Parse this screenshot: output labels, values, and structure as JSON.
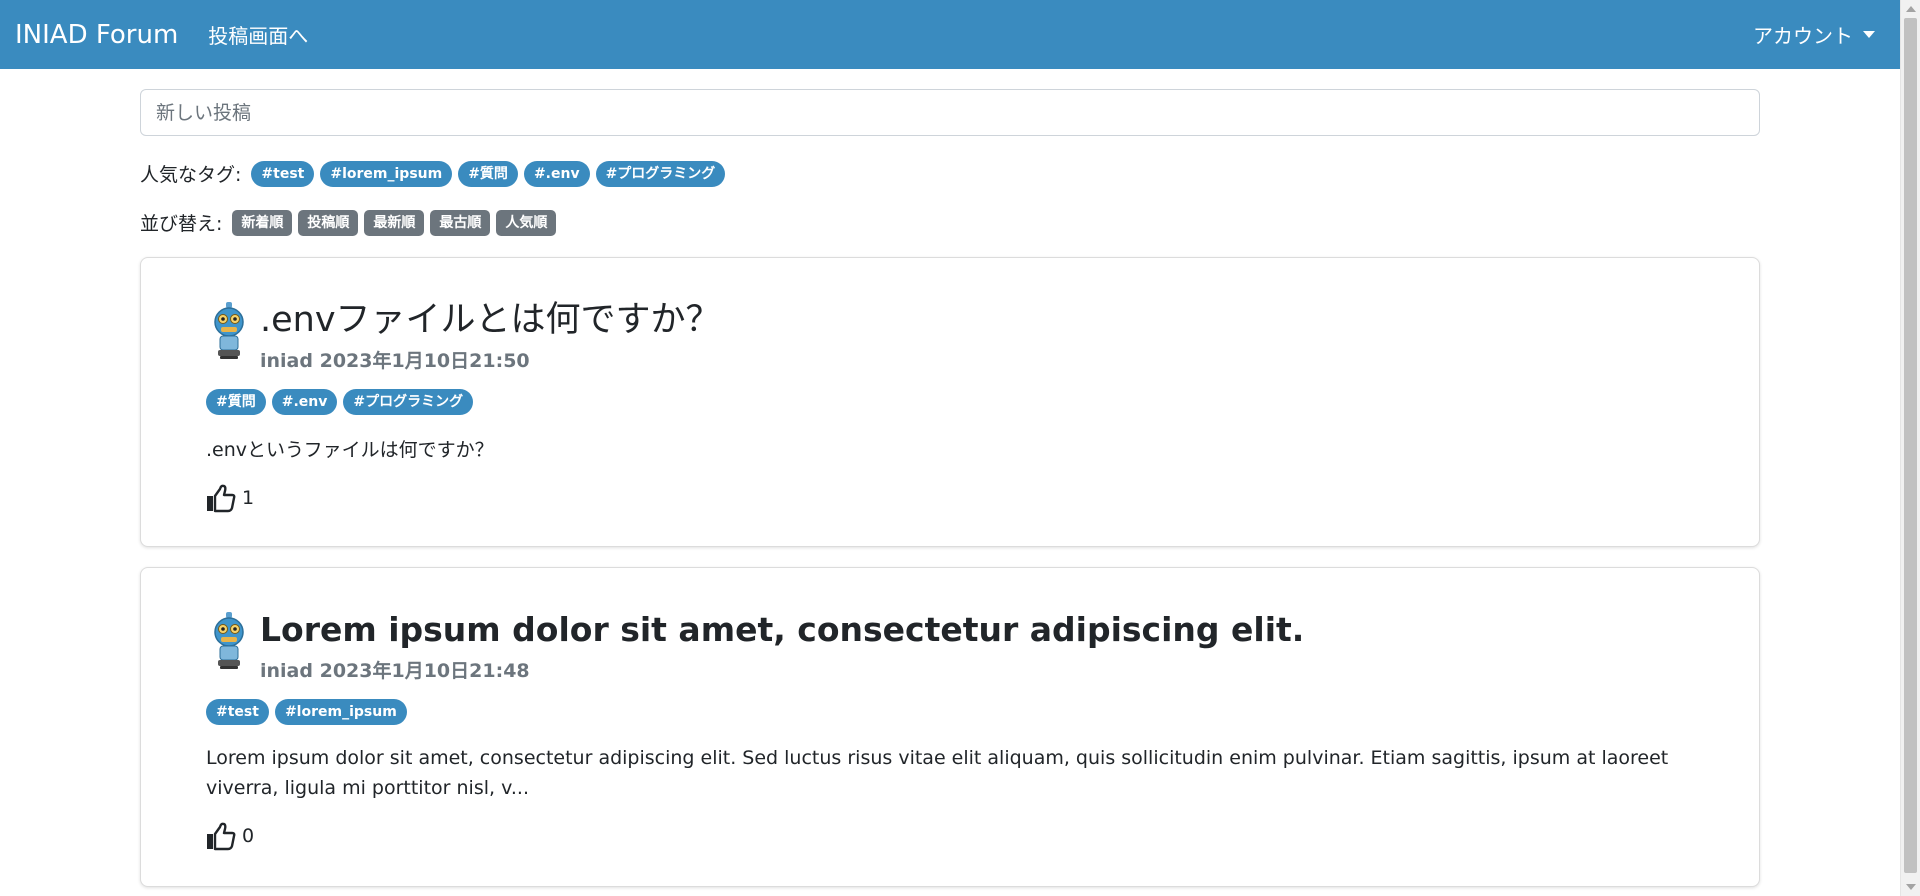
{
  "navbar": {
    "brand": "INIAD Forum",
    "post_link": "投稿画面へ",
    "account": "アカウント"
  },
  "search": {
    "placeholder": "新しい投稿"
  },
  "popular_tags": {
    "label": "人気なタグ:",
    "tags": [
      "#test",
      "#lorem_ipsum",
      "#質問",
      "#.env",
      "#プログラミング"
    ]
  },
  "sort": {
    "label": "並び替え:",
    "options": [
      "新着順",
      "投稿順",
      "最新順",
      "最古順",
      "人気順"
    ]
  },
  "posts": [
    {
      "title": ".envファイルとは何ですか？",
      "author": "iniad",
      "date": "2023年1月10日21:50",
      "tags": [
        "#質問",
        "#.env",
        "#プログラミング"
      ],
      "body": ".envというファイルは何ですか？",
      "likes": "1"
    },
    {
      "title": "Lorem ipsum dolor sit amet, consectetur adipiscing elit.",
      "author": "iniad",
      "date": "2023年1月10日21:48",
      "tags": [
        "#test",
        "#lorem_ipsum"
      ],
      "body": "Lorem ipsum dolor sit amet, consectetur adipiscing elit. Sed luctus risus vitae elit aliquam, quis sollicitudin enim pulvinar. Etiam sagittis, ipsum at laoreet viverra, ligula mi porttitor nisl, v...",
      "likes": "0"
    }
  ],
  "colors": {
    "navbar": "#3a8bbf",
    "tag_pill": "#3a8bbf",
    "sort_button": "#6c757d"
  },
  "icons": {
    "avatar": "robot-avatar-icon",
    "like": "thumbs-up-icon",
    "account_dropdown": "caret-down-icon"
  }
}
